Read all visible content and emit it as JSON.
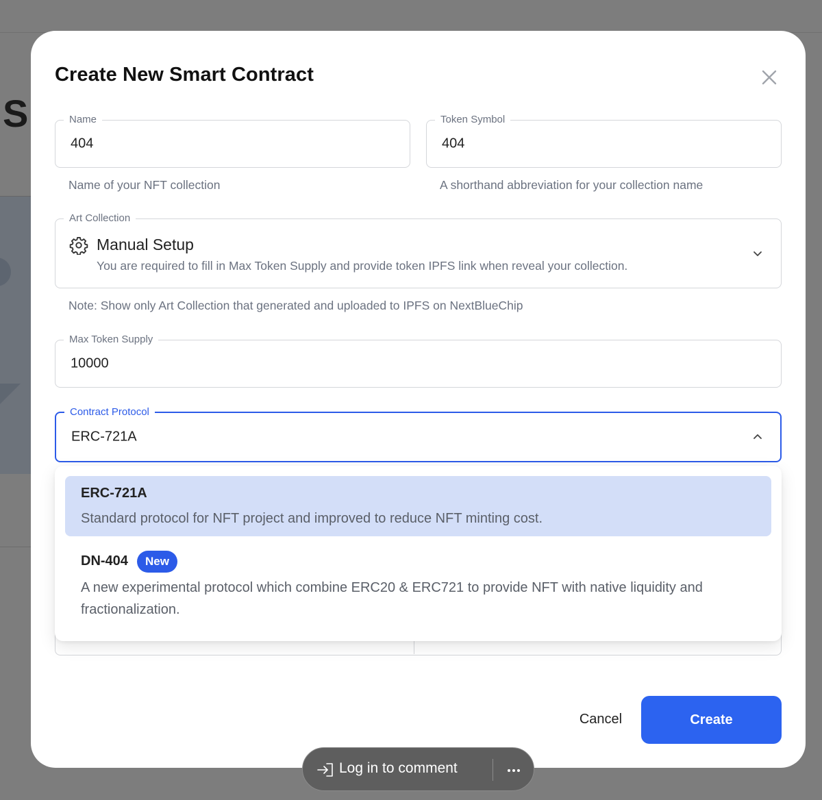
{
  "background": {
    "partial_heading": "S"
  },
  "modal": {
    "title": "Create New Smart Contract",
    "close_icon": "close-icon"
  },
  "fields": {
    "name": {
      "label": "Name",
      "value": "404",
      "helper": "Name of your NFT collection"
    },
    "token_symbol": {
      "label": "Token Symbol",
      "value": "404",
      "helper": "A shorthand abbreviation for your collection name"
    },
    "art_collection": {
      "label": "Art Collection",
      "icon": "gear-icon",
      "value": "Manual Setup",
      "description": "You are required to fill in Max Token Supply and provide token IPFS link when reveal your collection.",
      "note": "Note: Show only Art Collection that generated and uploaded to IPFS on NextBlueChip"
    },
    "max_token_supply": {
      "label": "Max Token Supply",
      "value": "10000"
    },
    "contract_protocol": {
      "label": "Contract Protocol",
      "value": "ERC-721A"
    }
  },
  "protocol_options": [
    {
      "title": "ERC-721A",
      "description": "Standard protocol for NFT project and improved to reduce NFT minting cost.",
      "selected": true
    },
    {
      "title": "DN-404",
      "badge": "New",
      "description": "A new experimental protocol which combine ERC20 & ERC721 to provide NFT with native liquidity and fractionalization.",
      "selected": false
    }
  ],
  "actions": {
    "cancel_label": "Cancel",
    "create_label": "Create"
  },
  "comment_bar": {
    "login_label": "Log in to comment",
    "login_icon": "login-icon",
    "more_icon": "more-icon"
  },
  "colors": {
    "accent": "#2C63F0",
    "selected_option_bg": "#D3DEF8",
    "badge_bg": "#2C5BE8"
  }
}
